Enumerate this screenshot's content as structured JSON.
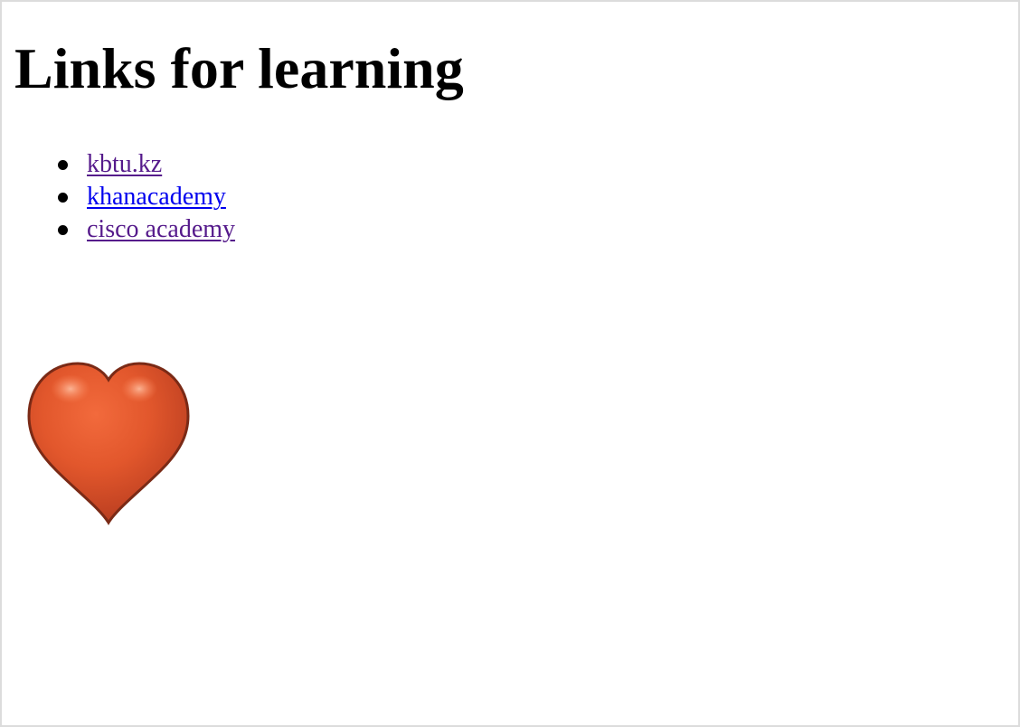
{
  "page": {
    "heading": "Links for learning"
  },
  "links": [
    {
      "label": "kbtu.kz",
      "state": "visited",
      "color": "#551a8b"
    },
    {
      "label": "khanacademy",
      "state": "unvisited",
      "color": "#0000ee"
    },
    {
      "label": "cisco academy",
      "state": "visited",
      "color": "#551a8b"
    }
  ],
  "image": {
    "icon": "heart-icon",
    "fill_color": "#d9552b",
    "outline_color": "#7a2a16"
  }
}
